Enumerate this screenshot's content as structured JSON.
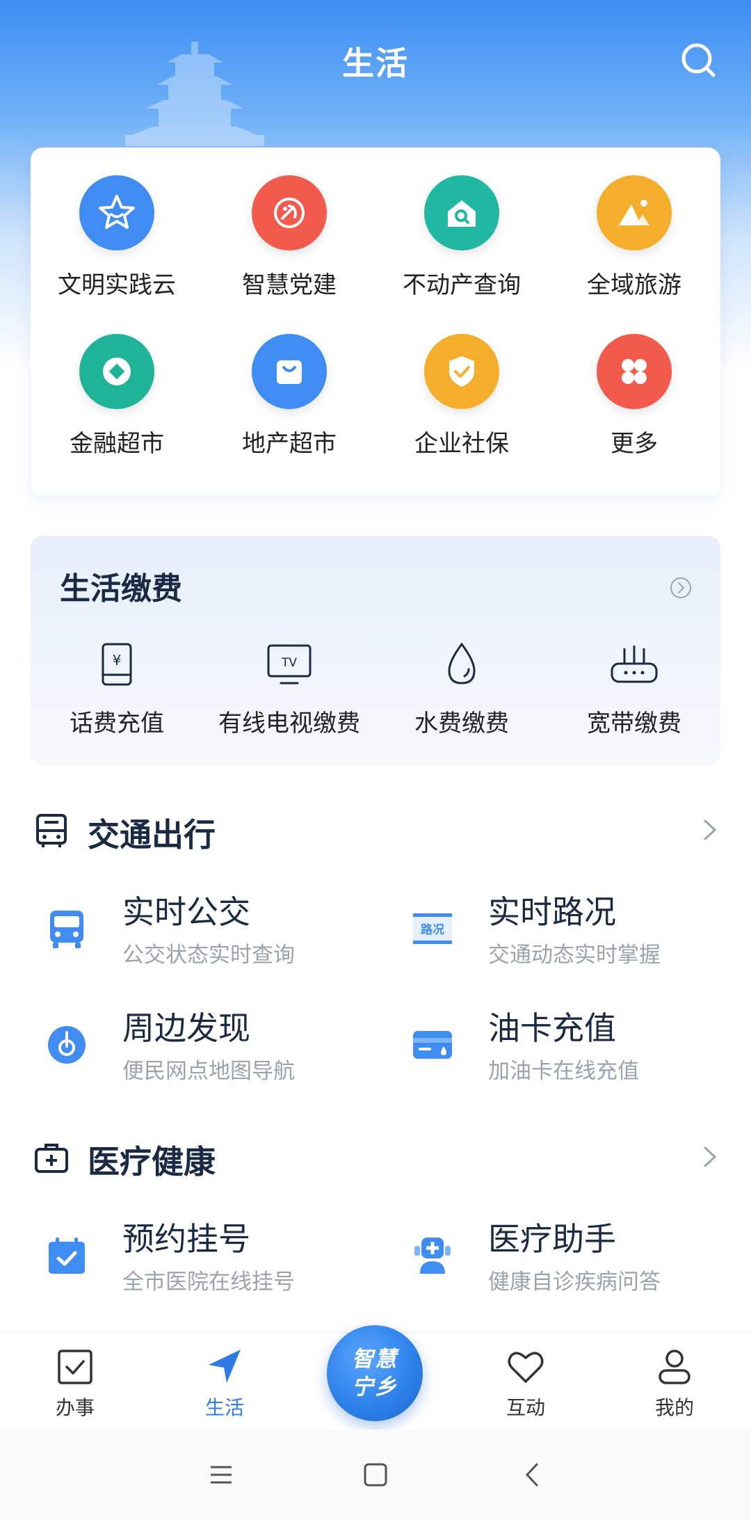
{
  "header": {
    "title": "生活"
  },
  "services": [
    {
      "label": "文明实践云",
      "icon": "star-smile-icon",
      "color": "#3f8df2"
    },
    {
      "label": "智慧党建",
      "icon": "party-emblem-icon",
      "color": "#f25b4b"
    },
    {
      "label": "不动产查询",
      "icon": "house-search-icon",
      "color": "#20b8a2"
    },
    {
      "label": "全域旅游",
      "icon": "mountain-icon",
      "color": "#f5ae2c"
    },
    {
      "label": "金融超市",
      "icon": "coin-icon",
      "color": "#1fb399"
    },
    {
      "label": "地产超市",
      "icon": "shopping-bag-icon",
      "color": "#3f8df2"
    },
    {
      "label": "企业社保",
      "icon": "shield-check-icon",
      "color": "#f5ae2c"
    },
    {
      "label": "更多",
      "icon": "more-grid-icon",
      "color": "#f25b4b"
    }
  ],
  "payments": {
    "title": "生活缴费",
    "items": [
      {
        "label": "话费充值",
        "icon": "phone-yen-icon"
      },
      {
        "label": "有线电视缴费",
        "icon": "tv-icon"
      },
      {
        "label": "水费缴费",
        "icon": "water-drop-icon"
      },
      {
        "label": "宽带缴费",
        "icon": "router-icon"
      }
    ]
  },
  "transport": {
    "title": "交通出行",
    "items": [
      {
        "title": "实时公交",
        "sub": "公交状态实时查询",
        "icon": "bus-icon"
      },
      {
        "title": "实时路况",
        "sub": "交通动态实时掌握",
        "icon": "road-sign-icon",
        "badge": "路况"
      },
      {
        "title": "周边发现",
        "sub": "便民网点地图导航",
        "icon": "location-disc-icon"
      },
      {
        "title": "油卡充值",
        "sub": "加油卡在线充值",
        "icon": "card-icon"
      }
    ]
  },
  "medical": {
    "title": "医疗健康",
    "items": [
      {
        "title": "预约挂号",
        "sub": "全市医院在线挂号",
        "icon": "calendar-check-icon"
      },
      {
        "title": "医疗助手",
        "sub": "健康自诊疾病问答",
        "icon": "medical-assistant-icon"
      }
    ]
  },
  "nav": {
    "items": [
      {
        "label": "办事",
        "icon": "checkbox-icon"
      },
      {
        "label": "生活",
        "icon": "navigation-arrow-icon",
        "active": true
      },
      {
        "label": "互动",
        "icon": "heart-icon"
      },
      {
        "label": "我的",
        "icon": "person-icon"
      }
    ],
    "center": {
      "line1": "智慧",
      "line2": "宁乡"
    }
  },
  "colors": {
    "accent": "#2f7be5",
    "title": "#1b2a44",
    "subtitle": "#9aa3ae"
  }
}
